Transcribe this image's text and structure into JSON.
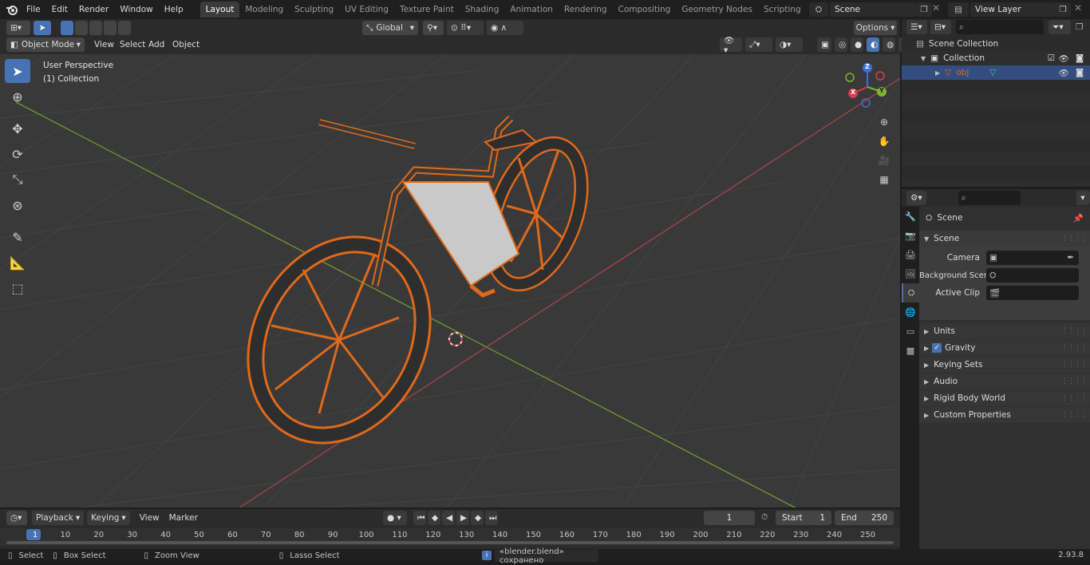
{
  "topbar": {
    "menus": [
      "File",
      "Edit",
      "Render",
      "Window",
      "Help"
    ],
    "workspaces": [
      "Layout",
      "Modeling",
      "Sculpting",
      "UV Editing",
      "Texture Paint",
      "Shading",
      "Animation",
      "Rendering",
      "Compositing",
      "Geometry Nodes",
      "Scripting"
    ],
    "active_workspace": "Layout",
    "add_workspace": "+",
    "scene_name": "Scene",
    "view_layer": "View Layer"
  },
  "viewport_header": {
    "mode": "Object Mode",
    "menus": [
      "View",
      "Select",
      "Add",
      "Object"
    ],
    "orientation": "Global",
    "options": "Options"
  },
  "viewport": {
    "perspective_label": "User Perspective",
    "collection_label": "(1) Collection",
    "gizmo": {
      "z": "Z",
      "y": "Y",
      "x": "X"
    },
    "accent_orange": "#e0691a",
    "grid_color": "#4a4a4a",
    "x_axis_color": "#a5434e",
    "y_axis_color": "#6f9a2c"
  },
  "timeline": {
    "menus": [
      "Playback",
      "Keying",
      "View",
      "Marker"
    ],
    "current_frame": "1",
    "start_label": "Start",
    "start_value": "1",
    "end_label": "End",
    "end_value": "250",
    "ruler_marks": [
      "1",
      "10",
      "20",
      "30",
      "40",
      "50",
      "60",
      "70",
      "80",
      "90",
      "100",
      "110",
      "120",
      "130",
      "140",
      "150",
      "160",
      "170",
      "180",
      "190",
      "200",
      "210",
      "220",
      "230",
      "240",
      "250"
    ]
  },
  "statusbar": {
    "select": "Select",
    "box_select": "Box Select",
    "zoom_view": "Zoom View",
    "lasso_select": "Lasso Select",
    "message": "«blender.blend» сохранено",
    "version": "2.93.8"
  },
  "outliner": {
    "rows": [
      {
        "label": "Scene Collection"
      },
      {
        "label": "Collection"
      },
      {
        "label": "obj"
      }
    ]
  },
  "properties": {
    "context": "Scene",
    "panel_title": "Scene",
    "fields": [
      {
        "label": "Camera"
      },
      {
        "label": "Background Scene"
      },
      {
        "label": "Active Clip"
      }
    ],
    "sections": [
      "Units",
      "Gravity",
      "Keying Sets",
      "Audio",
      "Rigid Body World",
      "Custom Properties"
    ]
  }
}
